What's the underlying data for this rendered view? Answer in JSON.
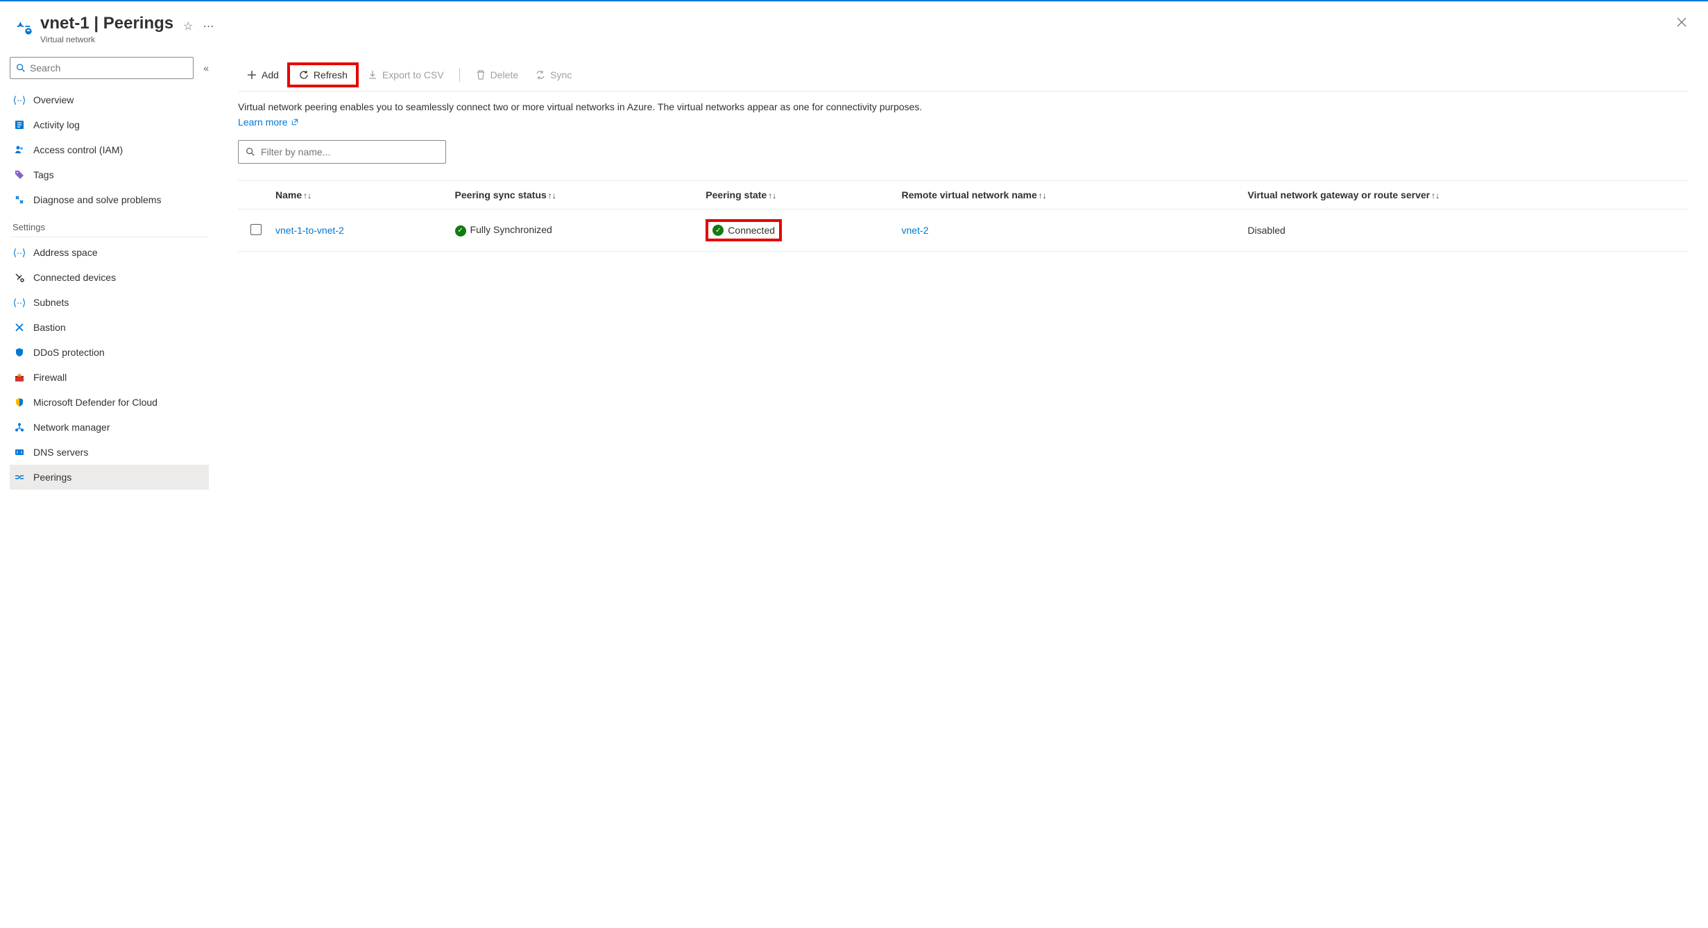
{
  "header": {
    "title": "vnet-1 | Peerings",
    "subtitle": "Virtual network"
  },
  "sidebar": {
    "search_placeholder": "Search",
    "top_items": [
      {
        "label": "Overview",
        "icon": "overview"
      },
      {
        "label": "Activity log",
        "icon": "activitylog"
      },
      {
        "label": "Access control (IAM)",
        "icon": "iam"
      },
      {
        "label": "Tags",
        "icon": "tags"
      },
      {
        "label": "Diagnose and solve problems",
        "icon": "diagnose"
      }
    ],
    "section_settings": "Settings",
    "settings_items": [
      {
        "label": "Address space",
        "icon": "address"
      },
      {
        "label": "Connected devices",
        "icon": "devices"
      },
      {
        "label": "Subnets",
        "icon": "subnets"
      },
      {
        "label": "Bastion",
        "icon": "bastion"
      },
      {
        "label": "DDoS protection",
        "icon": "ddos"
      },
      {
        "label": "Firewall",
        "icon": "firewall"
      },
      {
        "label": "Microsoft Defender for Cloud",
        "icon": "defender"
      },
      {
        "label": "Network manager",
        "icon": "netmgr"
      },
      {
        "label": "DNS servers",
        "icon": "dns"
      },
      {
        "label": "Peerings",
        "icon": "peerings",
        "active": true
      }
    ]
  },
  "toolbar": {
    "add": "Add",
    "refresh": "Refresh",
    "export": "Export to CSV",
    "delete": "Delete",
    "sync": "Sync"
  },
  "description": "Virtual network peering enables you to seamlessly connect two or more virtual networks in Azure. The virtual networks appear as one for connectivity purposes.",
  "learn_more": "Learn more",
  "filter_placeholder": "Filter by name...",
  "columns": {
    "name": "Name",
    "sync": "Peering sync status",
    "state": "Peering state",
    "remote": "Remote virtual network name",
    "gateway": "Virtual network gateway or route server"
  },
  "rows": [
    {
      "name": "vnet-1-to-vnet-2",
      "sync": "Fully Synchronized",
      "state": "Connected",
      "remote": "vnet-2",
      "gateway": "Disabled"
    }
  ]
}
